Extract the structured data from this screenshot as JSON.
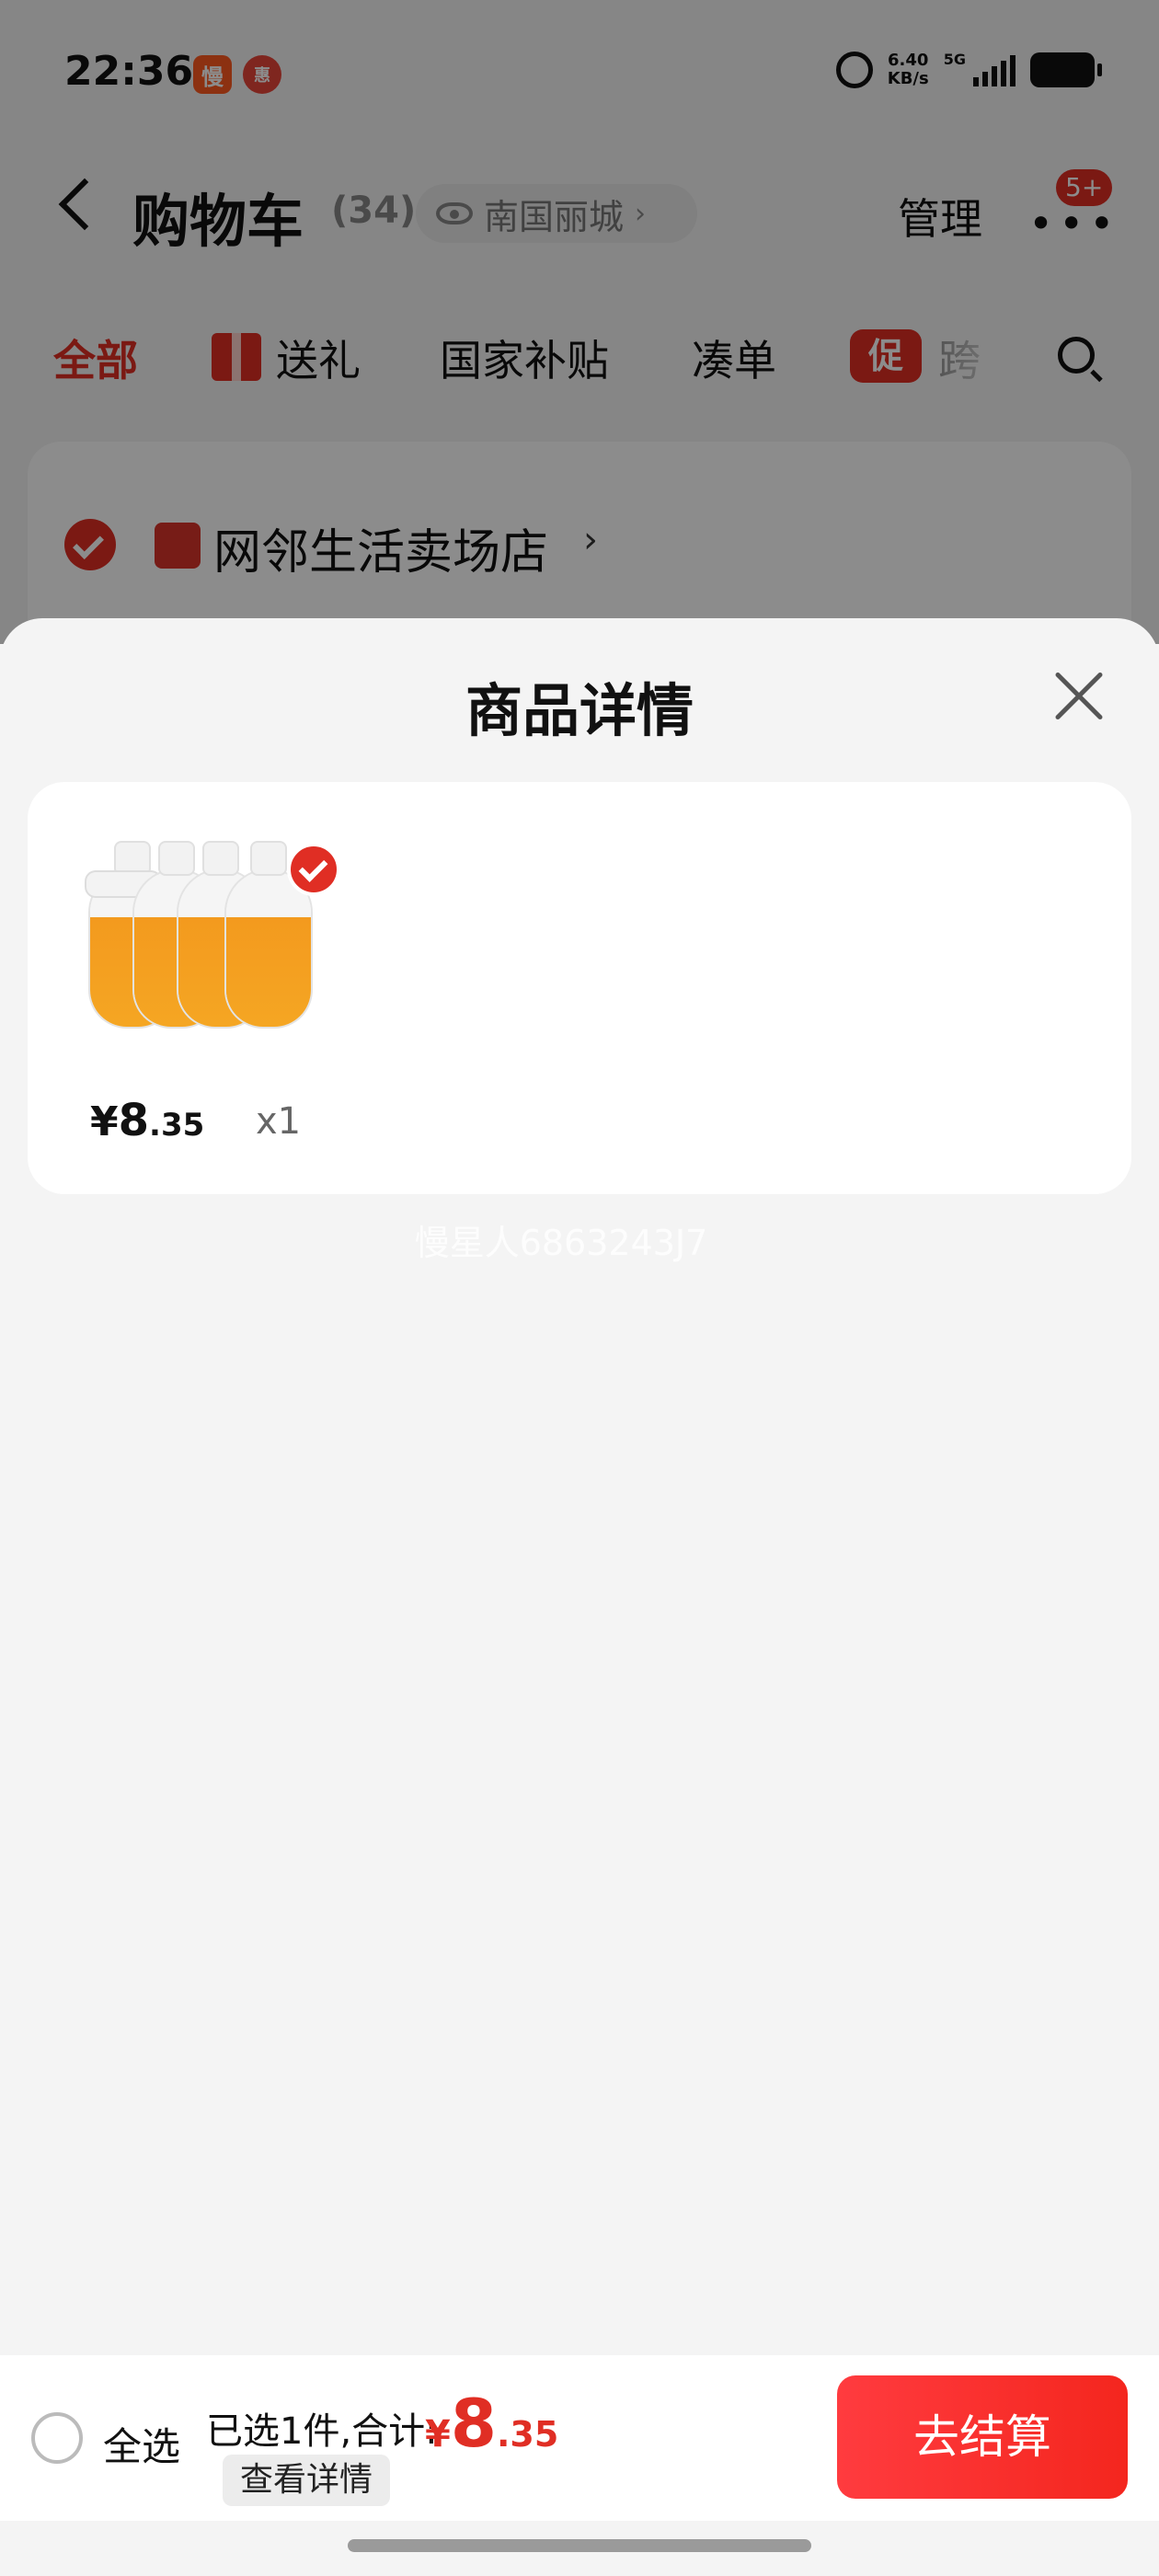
{
  "statusbar": {
    "time": "22:36",
    "app_icons": [
      "慢",
      "惠"
    ],
    "net_speed_value": "6.40",
    "net_speed_unit": "KB/s",
    "network": "5G"
  },
  "navbar": {
    "title": "购物车",
    "count": "(34)",
    "location": "南国丽城",
    "manage": "管理",
    "more_badge": "5+"
  },
  "tabs": [
    {
      "label": "全部",
      "active": true
    },
    {
      "label": "送礼",
      "icon": "gift-icon"
    },
    {
      "label": "国家补贴"
    },
    {
      "label": "凑单"
    },
    {
      "label": "跨",
      "icon_text": "促"
    }
  ],
  "store": {
    "name": "网邻生活卖场店"
  },
  "sheet": {
    "title": "商品详情",
    "item": {
      "price_symbol": "¥",
      "price_int": "8",
      "price_dec": ".35",
      "quantity": "x1"
    },
    "watermark": "慢星人686324​3J7"
  },
  "bottom_bar": {
    "select_all": "全选",
    "summary": "已选1件,合计:",
    "total_symbol": "¥",
    "total_int": "8",
    "total_dec": ".35",
    "view_details": "查看详情",
    "checkout": "去结算"
  },
  "colors": {
    "accent": "#e02e24",
    "checkout_gradient": [
      "#ff3b3f",
      "#f4261e"
    ]
  }
}
